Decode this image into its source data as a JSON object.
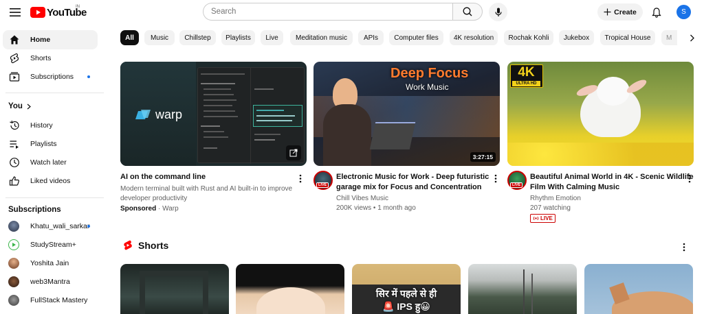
{
  "header": {
    "logo_text": "YouTube",
    "region": "IN",
    "search_placeholder": "Search",
    "create_label": "Create",
    "avatar_letter": "S"
  },
  "sidebar": {
    "main": [
      {
        "label": "Home",
        "icon": "home-icon",
        "active": true
      },
      {
        "label": "Shorts",
        "icon": "shorts-icon"
      },
      {
        "label": "Subscriptions",
        "icon": "subscriptions-icon",
        "dot": true
      }
    ],
    "you_heading": "You",
    "you_items": [
      {
        "label": "History",
        "icon": "history-icon"
      },
      {
        "label": "Playlists",
        "icon": "playlists-icon"
      },
      {
        "label": "Watch later",
        "icon": "clock-icon"
      },
      {
        "label": "Liked videos",
        "icon": "thumbs-up-icon"
      }
    ],
    "subs_heading": "Subscriptions",
    "subscriptions": [
      {
        "label": "Khatu_wali_sarkar",
        "dot": true
      },
      {
        "label": "StudyStream+"
      },
      {
        "label": "Yoshita Jain"
      },
      {
        "label": "web3Mantra"
      },
      {
        "label": "FullStack Mastery"
      }
    ]
  },
  "chips": [
    "All",
    "Music",
    "Chillstep",
    "Playlists",
    "Live",
    "Meditation music",
    "APIs",
    "Computer files",
    "4K resolution",
    "Rochak Kohli",
    "Jukebox",
    "Tropical House",
    "M"
  ],
  "videos": [
    {
      "title_1": "AI on the command line",
      "desc_1": "Modern terminal built with Rust and AI built-in to improve",
      "desc_2": "developer productivity",
      "sponsored": "Sponsored",
      "sponsor_name": "· Warp",
      "thumb_text": "warp"
    },
    {
      "title_1": "Electronic Music for Work - Deep futuristic",
      "title_2": "garage mix for Focus and Concentration",
      "channel": "Chill Vibes Music",
      "meta": "200K views • 1 month ago",
      "duration": "3:27:15",
      "thumb_title": "Deep Focus",
      "thumb_sub": "Work Music",
      "avatar_live": "LIVE"
    },
    {
      "title_1": "Beautiful Animal World in 4K - Scenic Wildlife",
      "title_2": "Film With Calming Music",
      "channel": "Rhythm Emotion",
      "meta": "207 watching",
      "live_badge": "LIVE",
      "thumb_4k": "4K",
      "thumb_uhd": "ULTRA HD",
      "avatar_live": "LIVE"
    }
  ],
  "shorts": {
    "heading": "Shorts",
    "third_text_1": "सिर में पहले से ही",
    "third_text_2": "🚨 IPS हु😀"
  },
  "colors": {
    "brand_red": "#ff0000",
    "live_red": "#cc0000",
    "accent_blue": "#1a73e8"
  }
}
